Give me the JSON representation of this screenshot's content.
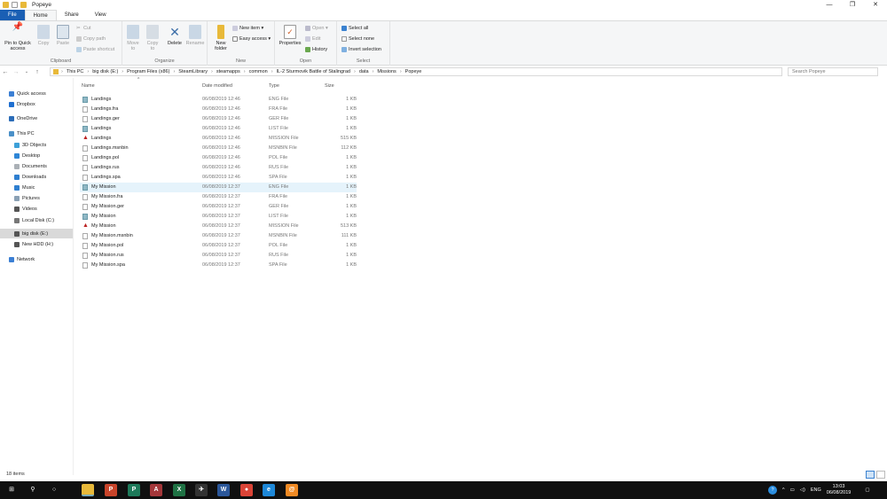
{
  "window": {
    "title": "Popeye",
    "minimize": "—",
    "maximize": "❐",
    "close": "✕"
  },
  "tabs": [
    "File",
    "Home",
    "Share",
    "View"
  ],
  "ribbon": {
    "clipboard": {
      "label": "Clipboard",
      "pin": "Pin to Quick access",
      "copy": "Copy",
      "paste": "Paste",
      "cut": "Cut",
      "copy_path": "Copy path",
      "paste_shortcut": "Paste shortcut"
    },
    "organize": {
      "label": "Organize",
      "move_to": "Move to",
      "copy_to": "Copy to",
      "delete": "Delete",
      "rename": "Rename"
    },
    "new": {
      "label": "New",
      "new_folder": "New folder",
      "new_item": "New item ▾",
      "easy_access": "Easy access ▾"
    },
    "open": {
      "label": "Open",
      "properties": "Properties",
      "open": "Open ▾",
      "edit": "Edit",
      "history": "History"
    },
    "select": {
      "label": "Select",
      "select_all": "Select all",
      "select_none": "Select none",
      "invert": "Invert selection"
    }
  },
  "address": {
    "crumbs": [
      "This PC",
      "big disk (E:)",
      "Program Files (x86)",
      "SteamLibrary",
      "steamapps",
      "common",
      "IL-2 Sturmovik Battle of Stalingrad",
      "data",
      "Missions",
      "Popeye"
    ],
    "search_placeholder": "Search Popeye"
  },
  "nav": [
    {
      "label": "Quick access",
      "icon": "star-icon",
      "color": "#3b7fd4"
    },
    {
      "label": "Dropbox",
      "icon": "dropbox-icon",
      "color": "#1f6fd0"
    },
    {
      "label": "OneDrive",
      "icon": "cloud-icon",
      "color": "#2b6cb8"
    },
    {
      "label": "This PC",
      "icon": "computer-icon",
      "color": "#4a90c8"
    },
    {
      "label": "3D Objects",
      "icon": "cube-icon",
      "color": "#3da0d8"
    },
    {
      "label": "Desktop",
      "icon": "desktop-icon",
      "color": "#2f86d6"
    },
    {
      "label": "Documents",
      "icon": "document-icon",
      "color": "#aab0b6"
    },
    {
      "label": "Downloads",
      "icon": "download-icon",
      "color": "#2f7fd0"
    },
    {
      "label": "Music",
      "icon": "music-icon",
      "color": "#2f7fd0"
    },
    {
      "label": "Pictures",
      "icon": "pictures-icon",
      "color": "#8aa0b4"
    },
    {
      "label": "Videos",
      "icon": "video-icon",
      "color": "#555"
    },
    {
      "label": "Local Disk (C:)",
      "icon": "drive-icon",
      "color": "#777"
    },
    {
      "label": "big disk (E:)",
      "icon": "drive-icon",
      "color": "#555"
    },
    {
      "label": "New HDD (H:)",
      "icon": "drive-icon",
      "color": "#555"
    },
    {
      "label": "Network",
      "icon": "network-icon",
      "color": "#3b7fd4"
    }
  ],
  "columns": {
    "name": "Name",
    "date": "Date modified",
    "type": "Type",
    "size": "Size"
  },
  "files": [
    {
      "name": "Landings",
      "date": "06/08/2019 12:46",
      "type": "ENG File",
      "size": "1 KB",
      "icon": "eng"
    },
    {
      "name": "Landings.fra",
      "date": "06/08/2019 12:46",
      "type": "FRA File",
      "size": "1 KB",
      "icon": "file"
    },
    {
      "name": "Landings.ger",
      "date": "06/08/2019 12:46",
      "type": "GER File",
      "size": "1 KB",
      "icon": "file"
    },
    {
      "name": "Landings",
      "date": "06/08/2019 12:46",
      "type": "LIST File",
      "size": "1 KB",
      "icon": "eng"
    },
    {
      "name": "Landings",
      "date": "06/08/2019 12:46",
      "type": "MISSION File",
      "size": "515 KB",
      "icon": "msn"
    },
    {
      "name": "Landings.msnbin",
      "date": "06/08/2019 12:46",
      "type": "MSNBIN File",
      "size": "112 KB",
      "icon": "file"
    },
    {
      "name": "Landings.pol",
      "date": "06/08/2019 12:46",
      "type": "POL File",
      "size": "1 KB",
      "icon": "file"
    },
    {
      "name": "Landings.rus",
      "date": "06/08/2019 12:46",
      "type": "RUS File",
      "size": "1 KB",
      "icon": "file"
    },
    {
      "name": "Landings.spa",
      "date": "06/08/2019 12:46",
      "type": "SPA File",
      "size": "1 KB",
      "icon": "file"
    },
    {
      "name": "My Mission",
      "date": "06/08/2019 12:37",
      "type": "ENG File",
      "size": "1 KB",
      "icon": "eng",
      "selected": true
    },
    {
      "name": "My Mission.fra",
      "date": "06/08/2019 12:37",
      "type": "FRA File",
      "size": "1 KB",
      "icon": "file"
    },
    {
      "name": "My Mission.ger",
      "date": "06/08/2019 12:37",
      "type": "GER File",
      "size": "1 KB",
      "icon": "file"
    },
    {
      "name": "My Mission",
      "date": "06/08/2019 12:37",
      "type": "LIST File",
      "size": "1 KB",
      "icon": "eng"
    },
    {
      "name": "My Mission",
      "date": "06/08/2019 12:37",
      "type": "MISSION File",
      "size": "513 KB",
      "icon": "msn"
    },
    {
      "name": "My Mission.msnbin",
      "date": "06/08/2019 12:37",
      "type": "MSNBIN File",
      "size": "111 KB",
      "icon": "file"
    },
    {
      "name": "My Mission.pol",
      "date": "06/08/2019 12:37",
      "type": "POL File",
      "size": "1 KB",
      "icon": "file"
    },
    {
      "name": "My Mission.rus",
      "date": "06/08/2019 12:37",
      "type": "RUS File",
      "size": "1 KB",
      "icon": "file"
    },
    {
      "name": "My Mission.spa",
      "date": "06/08/2019 12:37",
      "type": "SPA File",
      "size": "1 KB",
      "icon": "file"
    }
  ],
  "status": {
    "items": "18 items"
  },
  "taskbar": {
    "apps": [
      {
        "name": "file-explorer",
        "label": "",
        "color": "#e8b93a"
      },
      {
        "name": "powerpoint",
        "label": "P",
        "color": "#c8442a"
      },
      {
        "name": "publisher",
        "label": "P",
        "color": "#1e7a5a"
      },
      {
        "name": "access",
        "label": "A",
        "color": "#a4373a"
      },
      {
        "name": "excel",
        "label": "X",
        "color": "#1f7244"
      },
      {
        "name": "il2-game",
        "label": "✈",
        "color": "#333"
      },
      {
        "name": "word",
        "label": "W",
        "color": "#2b579a"
      },
      {
        "name": "chrome",
        "label": "●",
        "color": "#db4437"
      },
      {
        "name": "edge",
        "label": "e",
        "color": "#1e88d8"
      },
      {
        "name": "app-orange",
        "label": "@",
        "color": "#f08a24"
      }
    ],
    "lang": "ENG",
    "time": "13:03",
    "date": "06/08/2019"
  }
}
